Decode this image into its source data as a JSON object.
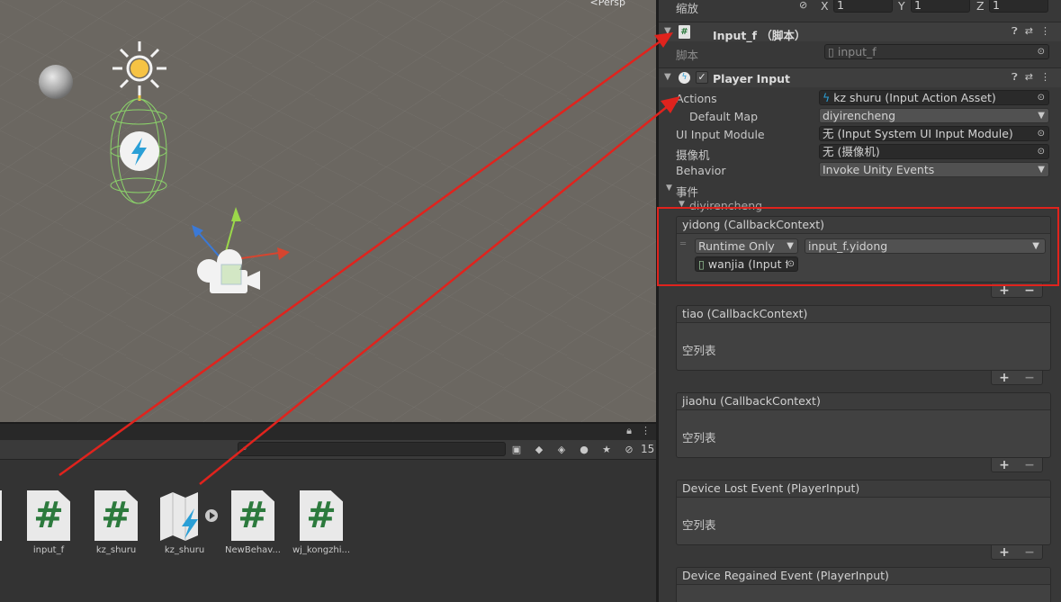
{
  "scene": {
    "persp_label": "<Persp"
  },
  "project": {
    "search_placeholder": "",
    "hidden_count": "15",
    "assets": [
      {
        "label": "input_f",
        "type": "script",
        "icon": "csharp-script-icon"
      },
      {
        "label": "kz_shuru",
        "type": "script",
        "icon": "csharp-script-icon"
      },
      {
        "label": "kz_shuru",
        "type": "input-action-asset",
        "icon": "input-actions-icon"
      },
      {
        "label": "NewBehav...",
        "type": "script",
        "icon": "csharp-script-icon"
      },
      {
        "label": "wj_kongzhi...",
        "type": "script",
        "icon": "csharp-script-icon"
      }
    ]
  },
  "inspector": {
    "scale_row": {
      "label": "缩放",
      "x_label": "X",
      "x": "1",
      "y_label": "Y",
      "y": "1",
      "z_label": "Z",
      "z": "1"
    },
    "input_f_component": {
      "title": "Input_f （脚本）",
      "script_label": "脚本",
      "script_value": "input_f"
    },
    "player_input": {
      "title": "Player Input",
      "enabled": true,
      "actions_label": "Actions",
      "actions_value": "kz shuru (Input Action Asset)",
      "default_map_label": "Default Map",
      "default_map_value": "diyirencheng",
      "ui_module_label": "UI Input Module",
      "ui_module_value": "无 (Input System UI Input Module)",
      "camera_label": "摄像机",
      "camera_value": "无 (摄像机)",
      "behavior_label": "Behavior",
      "behavior_value": "Invoke Unity Events"
    },
    "events": {
      "label": "事件",
      "map_label": "diyirencheng",
      "empty_text": "空列表",
      "yidong": {
        "title": "yidong (CallbackContext)",
        "runtime": "Runtime Only",
        "function": "input_f.yidong",
        "target": "wanjia (Input f"
      },
      "tiao": {
        "title": "tiao (CallbackContext)"
      },
      "jiaohu": {
        "title": "jiaohu (CallbackContext)"
      },
      "device_lost": {
        "title": "Device Lost Event (PlayerInput)"
      },
      "device_regained": {
        "title": "Device Regained Event (PlayerInput)"
      }
    }
  },
  "colors": {
    "annotation_red": "#e0231d",
    "script_green": "#2c7a3d",
    "inspector_bg": "#383838",
    "scene_bg": "#6b6761"
  }
}
